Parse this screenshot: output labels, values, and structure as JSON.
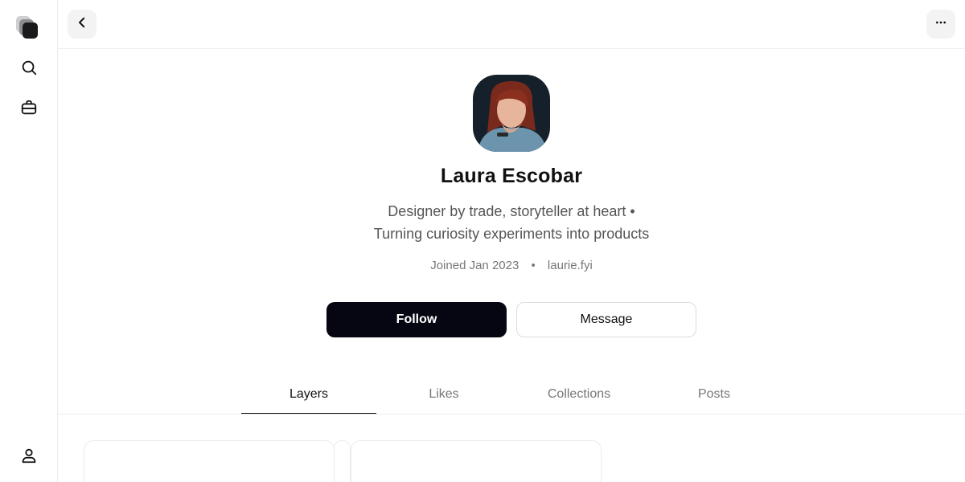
{
  "profile": {
    "name": "Laura Escobar",
    "bio_line1": "Designer by trade, storyteller at heart •",
    "bio_line2": "Turning curiosity experiments into products",
    "joined": "Joined Jan 2023",
    "separator": "•",
    "website": "laurie.fyi"
  },
  "actions": {
    "follow": "Follow",
    "message": "Message"
  },
  "tabs": [
    {
      "label": "Layers",
      "active": true
    },
    {
      "label": "Likes",
      "active": false
    },
    {
      "label": "Collections",
      "active": false
    },
    {
      "label": "Posts",
      "active": false
    }
  ],
  "icons": {
    "logo": "layers-logo-icon",
    "search": "search-icon",
    "bag": "briefcase-icon",
    "user": "user-icon",
    "back": "chevron-left-icon",
    "more": "more-horizontal-icon"
  },
  "colors": {
    "primary_button": "#060612",
    "icon_button_bg": "#f3f3f4",
    "border": "#ececec"
  }
}
